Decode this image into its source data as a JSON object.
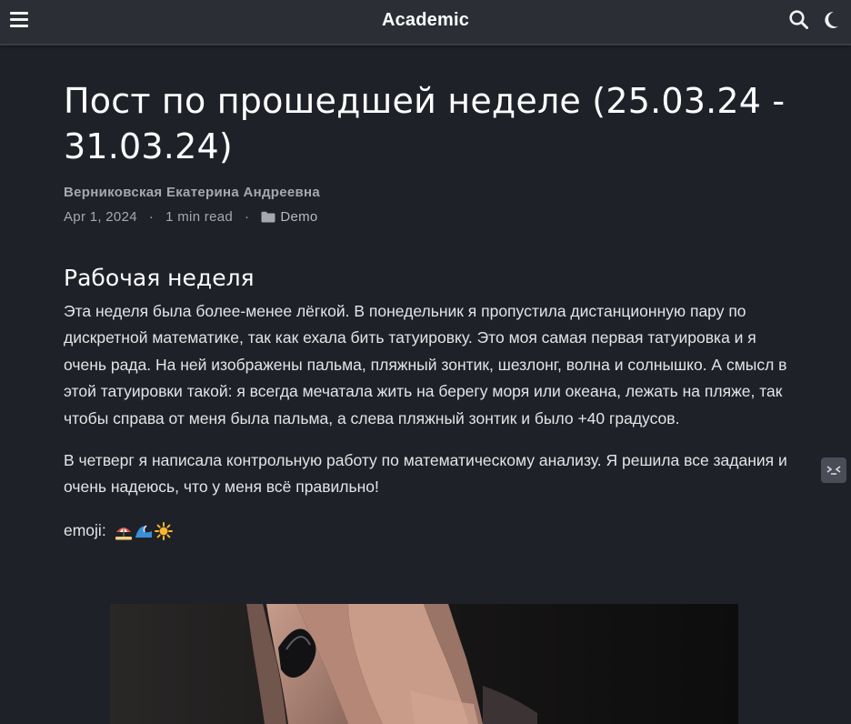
{
  "navbar": {
    "brand": "Academic",
    "menu_icon": "hamburger-menu-icon",
    "search_icon": "search-icon",
    "theme_icon": "moon-icon"
  },
  "article": {
    "title": "Пост по прошедшей неделе (25.03.24 - 31.03.24)",
    "author": "Верниковская Екатерина Андреевна",
    "date": "Apr 1, 2024",
    "separator": "·",
    "reading_time": "1 min read",
    "category": "Demo",
    "category_icon": "folder-icon",
    "section_heading": "Рабочая неделя",
    "paragraph_1": "Эта неделя была более-менее лёгкой. В понедельник я пропустила дистанционную пару по дискретной математике, так как ехала бить татуировку. Это моя самая первая татуировка и я очень рада. На ней изображены пальма, пляжный зонтик, шезлонг, волна и солнышко. А смысл в этой татуировки такой: я всегда мечатала жить на берегу моря или океана, лежать на пляже, так чтобы справа от меня была пальма, а слева пляжный зонтик и было +40 градусов.",
    "paragraph_2": "В четверг я написала контрольную работу по математическому анализу. Я решила все задания и очень надеюсь, что у меня всё правильно!",
    "emoji_label": "emoji:",
    "emoji_icons": [
      "beach-umbrella-icon",
      "wave-icon",
      "sun-icon"
    ]
  },
  "sidebar_tab_icon": "terminal-prompt-icon",
  "colors": {
    "background": "#1e2128",
    "navbar": "#2b2e35",
    "muted_text": "#a6a8ad",
    "body_text": "#e4e4e6"
  }
}
